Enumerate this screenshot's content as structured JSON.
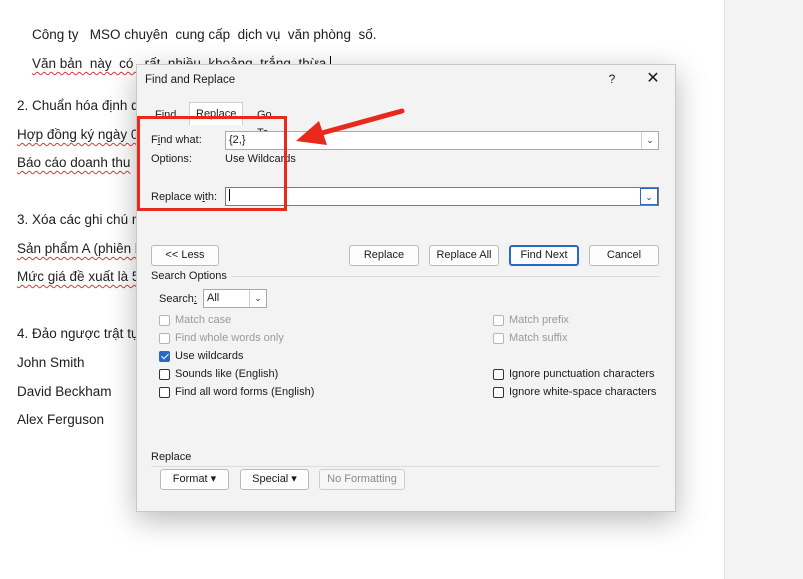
{
  "document": {
    "lines": [
      "Công ty   MSO chuyên  cung cấp  dịch vụ  văn phòng  số.",
      "Văn bản  này  có   rất  nhiều  khoảng  trắng  thừa.",
      "2. Chuẩn hóa định d",
      "Hợp đồng ký ngày 0",
      "Báo cáo doanh thu",
      "3. Xóa các ghi chú n",
      "Sản phẩm A (phiên b",
      "Mức giá đề xuất là 5",
      "4. Đảo ngược trật tự",
      "John Smith",
      "David Beckham",
      "Alex Ferguson"
    ]
  },
  "dialog": {
    "title": "Find and Replace",
    "help": "?",
    "close": "✕",
    "tabs": [
      "Find",
      "Replace",
      "Go To"
    ],
    "find_label": "Find what:",
    "find_value": "{2,}",
    "options_label": "Options:",
    "options_value": "Use Wildcards",
    "replace_label": "Replace with:",
    "replace_value": "",
    "buttons": {
      "less": "<< Less",
      "replace": "Replace",
      "replace_all": "Replace All",
      "find_next": "Find Next",
      "cancel": "Cancel"
    },
    "search_options_label": "Search Options",
    "search_label": "Search:",
    "search_value": "All",
    "checkboxes_left": [
      {
        "label": "Match case",
        "checked": false,
        "enabled": false
      },
      {
        "label": "Find whole words only",
        "checked": false,
        "enabled": false
      },
      {
        "label": "Use wildcards",
        "checked": true,
        "enabled": true
      },
      {
        "label": "Sounds like (English)",
        "checked": false,
        "enabled": true
      },
      {
        "label": "Find all word forms (English)",
        "checked": false,
        "enabled": true
      }
    ],
    "checkboxes_right": [
      {
        "label": "Match prefix",
        "checked": false,
        "enabled": false
      },
      {
        "label": "Match suffix",
        "checked": false,
        "enabled": false
      },
      {
        "label": "Ignore punctuation characters",
        "checked": false,
        "enabled": true
      },
      {
        "label": "Ignore white-space characters",
        "checked": false,
        "enabled": true
      }
    ],
    "replace_section_label": "Replace",
    "format_button": "Format ▾",
    "special_button": "Special ▾",
    "no_formatting_button": "No Formatting"
  },
  "colors": {
    "annotation": "#e8291c",
    "accent": "#2b67c4"
  }
}
